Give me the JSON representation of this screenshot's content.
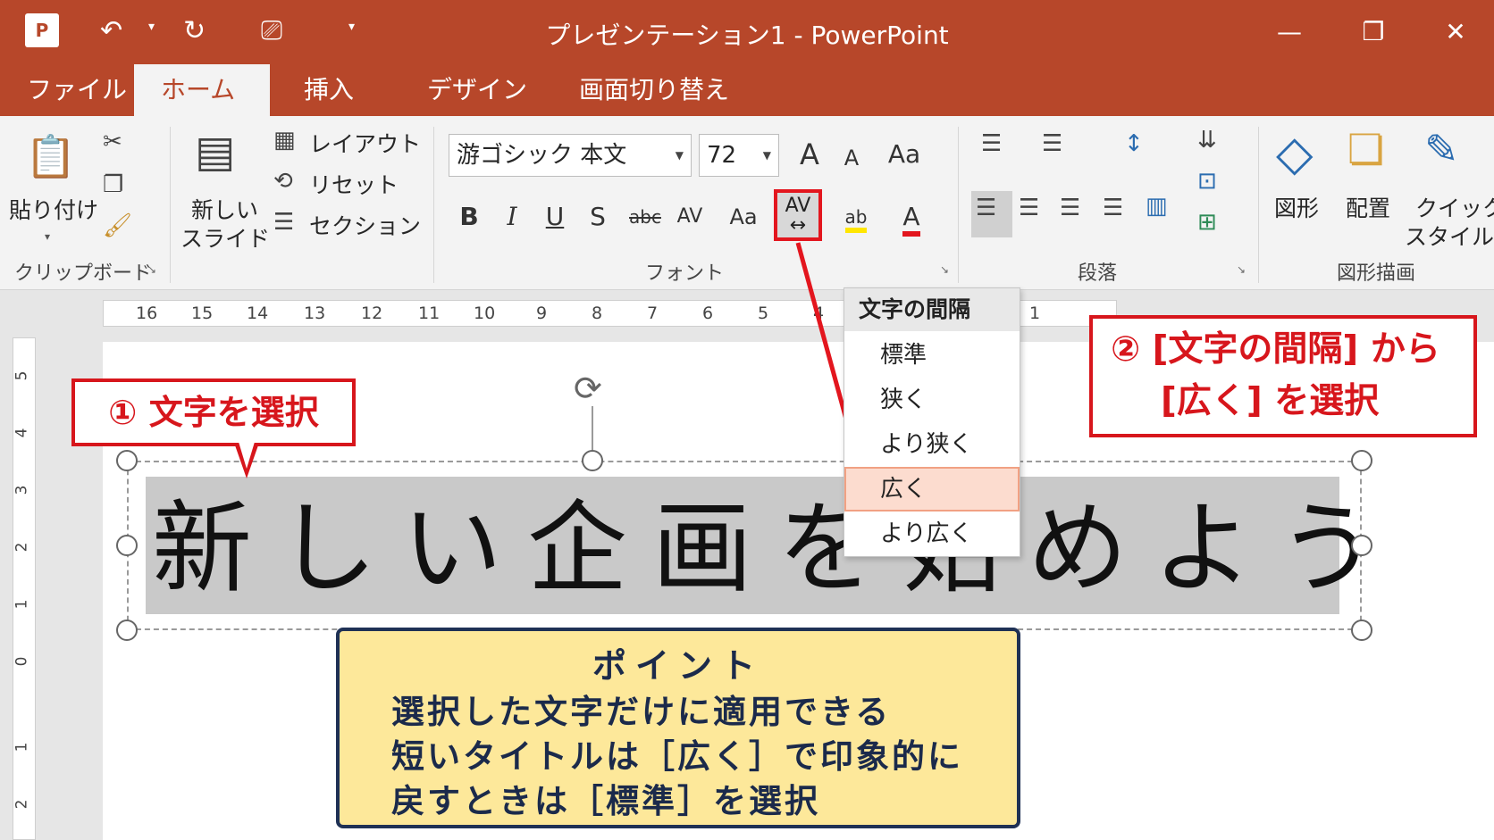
{
  "window": {
    "title": "プレゼンテーション1 - PowerPoint",
    "app_logo": "P",
    "minimize": "—",
    "restore": "❐",
    "close": "✕"
  },
  "qat": {
    "undo": "↶",
    "redo": "↻",
    "present": "⎚",
    "more": "▾"
  },
  "tabs": [
    {
      "label": "ファイル"
    },
    {
      "label": "ホーム"
    },
    {
      "label": "挿入"
    },
    {
      "label": "デザイン"
    },
    {
      "label": "画面切り替え"
    }
  ],
  "ribbon": {
    "clipboard": {
      "paste": "貼り付け",
      "group": "クリップボード"
    },
    "slides": {
      "new_slide_1": "新しい",
      "new_slide_2": "スライド",
      "layout": "レイアウト",
      "reset": "リセット",
      "section": "セクション"
    },
    "font": {
      "font_name": "游ゴシック 本文",
      "font_size": "72",
      "grow": "A",
      "shrink": "A",
      "case": "Aa",
      "bold": "B",
      "italic": "I",
      "underline": "U",
      "shadow": "S",
      "strike": "abc",
      "kerning": "AV",
      "case2": "Aa",
      "spacing": "AV",
      "highlight": "ab",
      "color": "A",
      "group": "フォント"
    },
    "paragraph": {
      "group": "段落"
    },
    "drawing": {
      "shapes": "図形",
      "arrange": "配置",
      "quick_1": "クイック",
      "quick_2": "スタイル",
      "group": "図形描画"
    }
  },
  "ruler": [
    "16",
    "15",
    "14",
    "13",
    "12",
    "11",
    "10",
    "9",
    "8",
    "7",
    "6",
    "5",
    "4",
    "1"
  ],
  "vruler": [
    "5",
    "4",
    "3",
    "2",
    "1",
    "0",
    "1",
    "2"
  ],
  "slide": {
    "title_text": "新しい企画を始めよう"
  },
  "callouts": {
    "step1": "① 文字を選択",
    "step2_line1": "② [文字の間隔] から",
    "step2_line2": "[広く] を選択"
  },
  "point": {
    "title": "ポイント",
    "line1": "選択した文字だけに適用できる",
    "line2": "短いタイトルは［広く］で印象的に",
    "line3": "戻すときは［標準］を選択"
  },
  "spacing_menu": {
    "header": "文字の間隔",
    "items": [
      "標準",
      "狭く",
      "より狭く",
      "広く",
      "より広く"
    ],
    "selected": "広く"
  },
  "colors": {
    "accent": "#b7472a",
    "callout": "#d7161c",
    "point_bg": "#fde89a"
  }
}
